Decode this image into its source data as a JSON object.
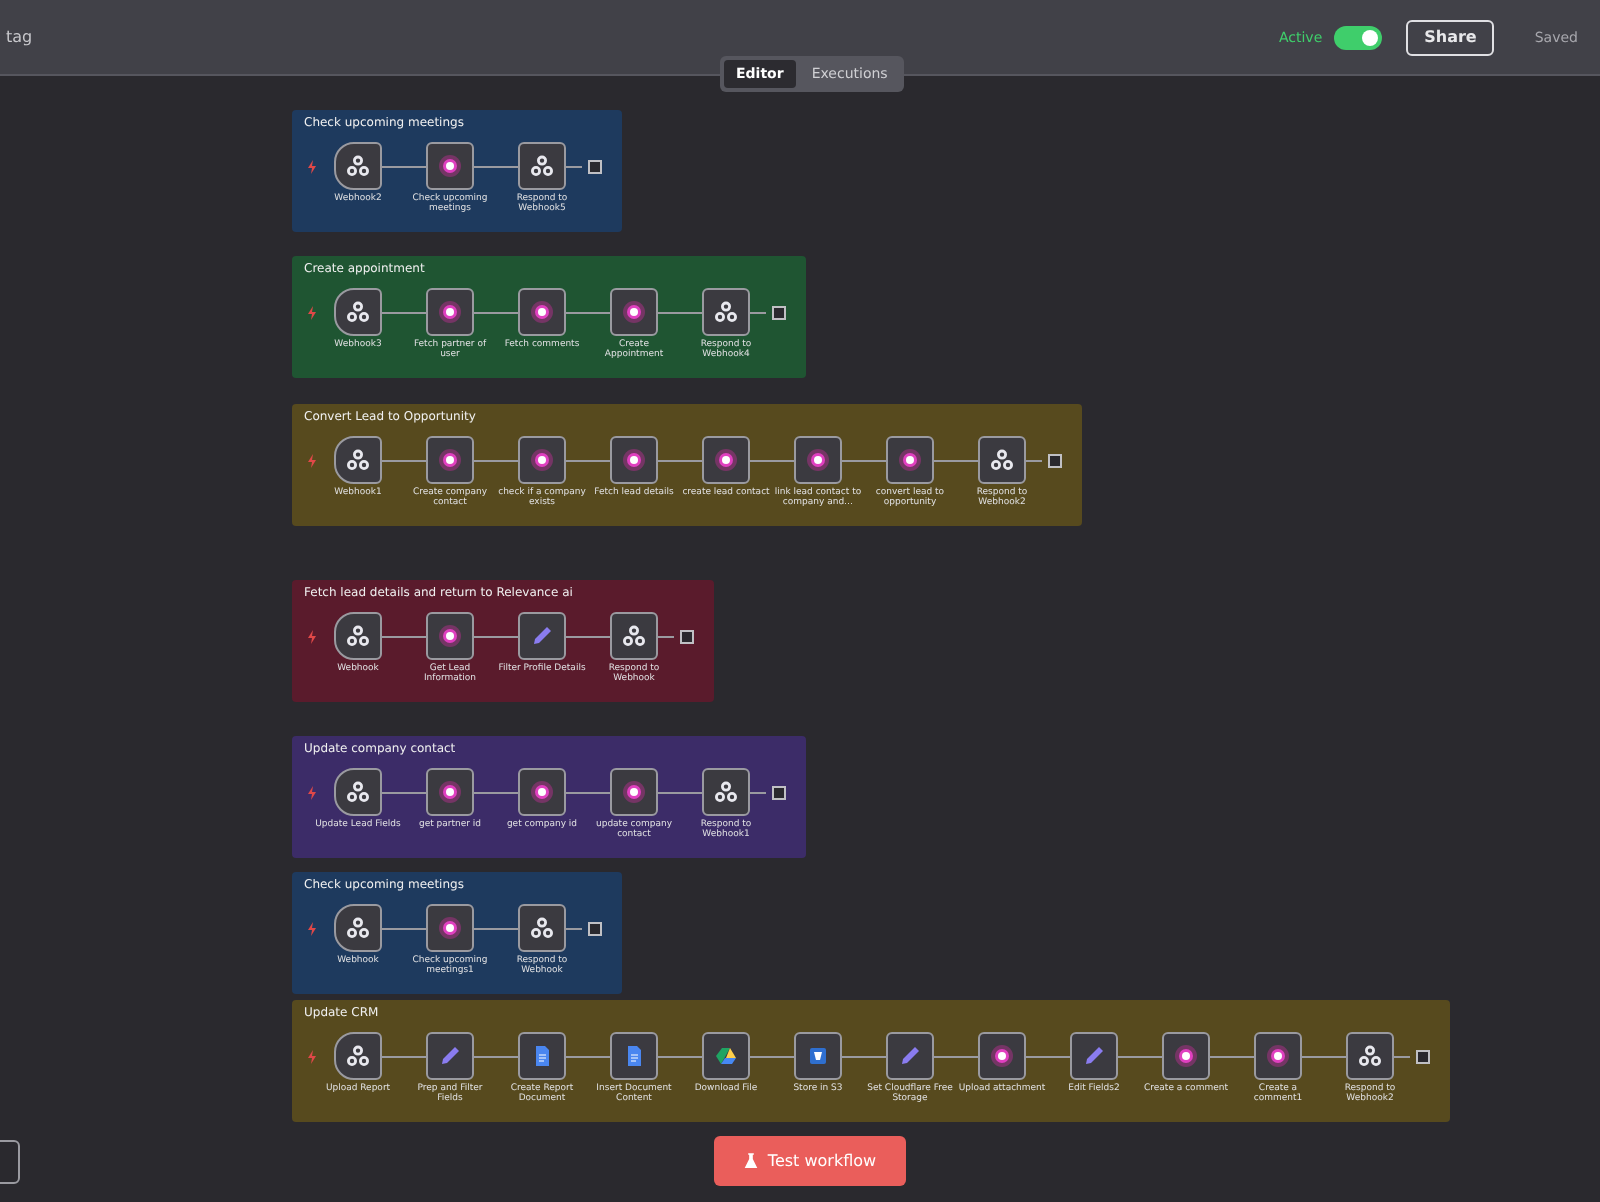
{
  "header": {
    "tag_text": "tag",
    "active_label": "Active",
    "active_toggle": {
      "on": true
    },
    "share": "Share",
    "status": "Saved"
  },
  "tabs": [
    {
      "label": "Editor",
      "selected": true
    },
    {
      "label": "Executions",
      "selected": false
    }
  ],
  "groups": [
    {
      "title": "Check upcoming meetings",
      "color": "#1e3a5e",
      "nodes": [
        {
          "kind": "trigger",
          "label": "Webhook2"
        },
        {
          "kind": "ai",
          "label": "Check upcoming meetings"
        },
        {
          "kind": "webhook",
          "label": "Respond to Webhook5"
        }
      ]
    },
    {
      "title": "Create appointment",
      "color": "#1f5532",
      "nodes": [
        {
          "kind": "trigger",
          "label": "Webhook3"
        },
        {
          "kind": "ai",
          "label": "Fetch partner of user"
        },
        {
          "kind": "ai",
          "label": "Fetch comments"
        },
        {
          "kind": "ai",
          "label": "Create Appointment"
        },
        {
          "kind": "webhook",
          "label": "Respond to Webhook4"
        }
      ]
    },
    {
      "title": "Convert Lead to Opportunity",
      "color": "#574a1e",
      "nodes": [
        {
          "kind": "trigger",
          "label": "Webhook1"
        },
        {
          "kind": "ai",
          "label": "Create company contact"
        },
        {
          "kind": "ai",
          "label": "check if a company exists"
        },
        {
          "kind": "ai",
          "label": "Fetch lead details"
        },
        {
          "kind": "ai",
          "label": "create lead contact"
        },
        {
          "kind": "ai",
          "label": "link lead contact to company and…"
        },
        {
          "kind": "ai",
          "label": "convert lead to opportunity"
        },
        {
          "kind": "webhook",
          "label": "Respond to Webhook2"
        }
      ]
    },
    {
      "title": "Fetch lead details and return to Relevance ai",
      "color": "#5a1b2c",
      "nodes": [
        {
          "kind": "trigger",
          "label": "Webhook"
        },
        {
          "kind": "ai",
          "label": "Get Lead Information"
        },
        {
          "kind": "edit",
          "label": "Filter Profile Details"
        },
        {
          "kind": "webhook",
          "label": "Respond to Webhook"
        }
      ]
    },
    {
      "title": "Update company contact",
      "color": "#3c2c68",
      "nodes": [
        {
          "kind": "trigger",
          "label": "Update Lead Fields"
        },
        {
          "kind": "ai",
          "label": "get partner id"
        },
        {
          "kind": "ai",
          "label": "get company id"
        },
        {
          "kind": "ai",
          "label": "update company contact"
        },
        {
          "kind": "webhook",
          "label": "Respond to Webhook1"
        }
      ]
    },
    {
      "title": "Check upcoming meetings",
      "color": "#1e3a5e",
      "nodes": [
        {
          "kind": "trigger",
          "label": "Webhook"
        },
        {
          "kind": "ai",
          "label": "Check upcoming meetings1"
        },
        {
          "kind": "webhook",
          "label": "Respond to Webhook"
        }
      ]
    },
    {
      "title": "Update CRM",
      "color": "#574a1e",
      "nodes": [
        {
          "kind": "trigger",
          "label": "Upload Report"
        },
        {
          "kind": "edit",
          "label": "Prep and Filter Fields"
        },
        {
          "kind": "docs",
          "label": "Create Report Document"
        },
        {
          "kind": "docs",
          "label": "Insert Document Content"
        },
        {
          "kind": "drive",
          "label": "Download File"
        },
        {
          "kind": "s3",
          "label": "Store in S3"
        },
        {
          "kind": "edit",
          "label": "Set Cloudflare Free Storage"
        },
        {
          "kind": "ai",
          "label": "Upload attachment"
        },
        {
          "kind": "edit",
          "label": "Edit Fields2"
        },
        {
          "kind": "ai",
          "label": "Create a comment"
        },
        {
          "kind": "ai",
          "label": "Create a comment1"
        },
        {
          "kind": "webhook",
          "label": "Respond to Webhook2"
        }
      ]
    }
  ],
  "test_button": "Test workflow"
}
